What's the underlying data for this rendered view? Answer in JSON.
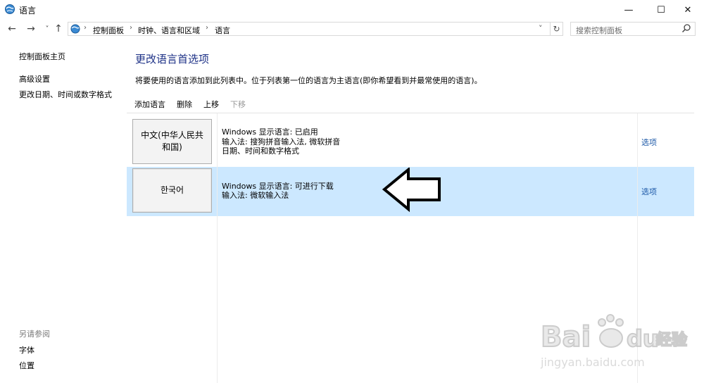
{
  "window": {
    "title": "语言",
    "controls": {
      "minimize": "—",
      "maximize": "☐",
      "close": "✕"
    }
  },
  "nav": {
    "back": "←",
    "forward": "→",
    "recent": "˅",
    "up": "↑",
    "breadcrumbs": [
      "控制面板",
      "时钟、语言和区域",
      "语言"
    ],
    "dropdown": "˅",
    "refresh": "↻",
    "search_placeholder": "搜索控制面板"
  },
  "sidebar": {
    "home": "控制面板主页",
    "advanced": "高级设置",
    "date_time": "更改日期、时间或数字格式",
    "see_also_title": "另请参阅",
    "see_also": [
      "字体",
      "位置"
    ]
  },
  "main": {
    "title": "更改语言首选项",
    "description": "将要使用的语言添加到此列表中。位于列表第一位的语言为主语言(即你希望看到并最常使用的语言)。",
    "toolbar": {
      "add": "添加语言",
      "remove": "删除",
      "up": "上移",
      "down": "下移"
    },
    "languages": [
      {
        "name": "中文(中华人民共和国)",
        "details": [
          "Windows 显示语言: 已启用",
          "输入法: 搜狗拼音输入法, 微软拼音",
          "日期、时间和数字格式"
        ],
        "options": "选项"
      },
      {
        "name": "한국어",
        "details": [
          "Windows 显示语言: 可进行下载",
          "输入法: 微软输入法"
        ],
        "options": "选项",
        "selected": true
      }
    ]
  },
  "watermark": {
    "brand": "Bai",
    "brand_cn": "经验",
    "url": "jingyan.baidu.com"
  },
  "colors": {
    "accent_title": "#1e3287",
    "selection": "#cce8ff",
    "link": "#1e5aa8"
  }
}
